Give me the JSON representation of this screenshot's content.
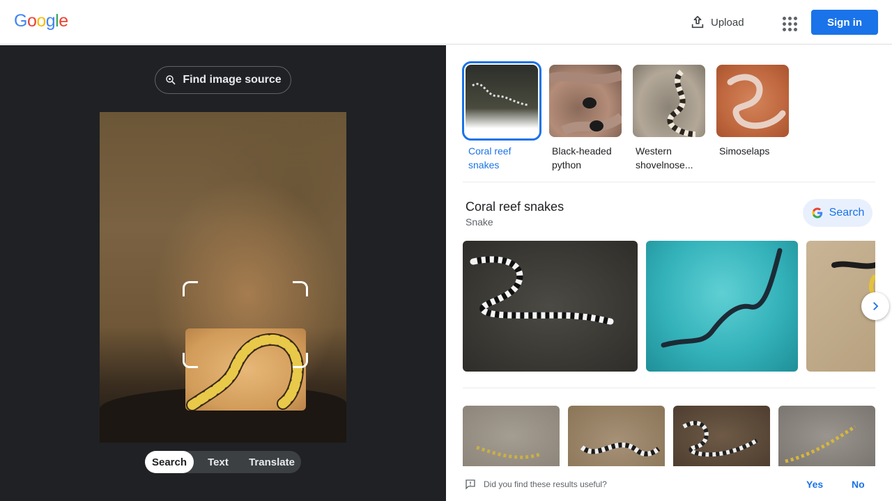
{
  "header": {
    "logo": "Google",
    "upload_label": "Upload",
    "signin_label": "Sign in"
  },
  "left": {
    "find_source_label": "Find image source",
    "modes": [
      {
        "label": "Search",
        "active": true
      },
      {
        "label": "Text",
        "active": false
      },
      {
        "label": "Translate",
        "active": false
      }
    ]
  },
  "suggestions": [
    {
      "label": "Coral reef snakes",
      "selected": true
    },
    {
      "label": "Black-headed python",
      "selected": false
    },
    {
      "label": "Western shovelnose...",
      "selected": false
    },
    {
      "label": "Simoselaps",
      "selected": false
    }
  ],
  "entity": {
    "title": "Coral reef snakes",
    "subtitle": "Snake",
    "search_label": "Search"
  },
  "feedback": {
    "question": "Did you find these results useful?",
    "yes_label": "Yes",
    "no_label": "No"
  },
  "colors": {
    "accent": "#1a73e8",
    "left_bg": "#202124"
  }
}
